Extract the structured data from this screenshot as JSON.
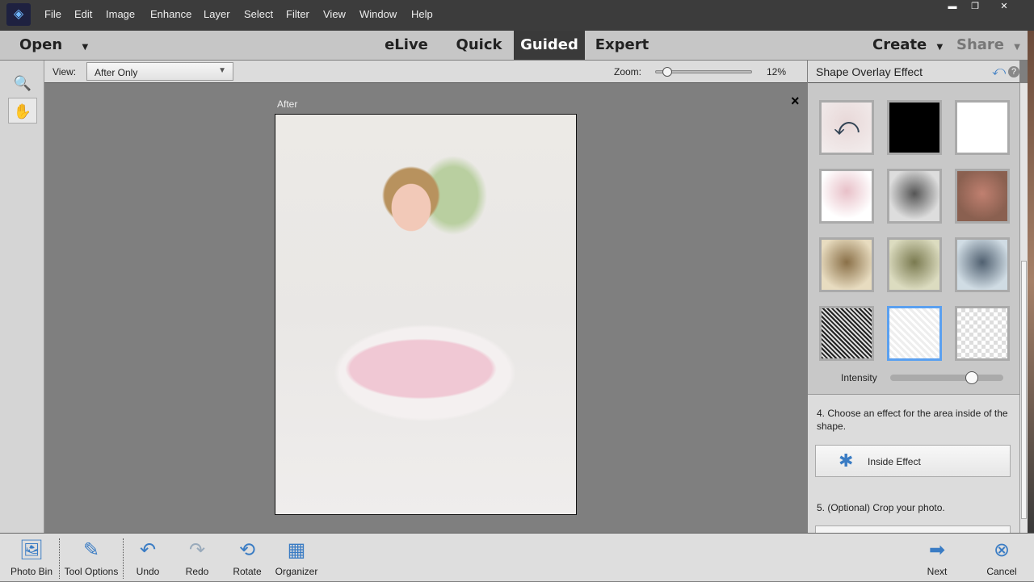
{
  "menu": [
    "File",
    "Edit",
    "Image",
    "Enhance",
    "Layer",
    "Select",
    "Filter",
    "View",
    "Window",
    "Help"
  ],
  "window_controls": {
    "minimize": "▬",
    "maximize": "❐",
    "close": "✕"
  },
  "modes": {
    "open": "Open",
    "elive": "eLive",
    "quick": "Quick",
    "guided": "Guided",
    "expert": "Expert",
    "create": "Create",
    "share": "Share"
  },
  "options": {
    "view_label": "View:",
    "view_value": "After Only",
    "zoom_label": "Zoom:",
    "zoom_value": "12%",
    "zoom_fraction": 0.12
  },
  "canvas": {
    "label": "After",
    "close": "×"
  },
  "panel": {
    "title": "Shape Overlay Effect",
    "intensity_label": "Intensity",
    "intensity": 0.72,
    "step4": "4. Choose an effect for the area inside of the shape.",
    "inside_button": "Inside Effect",
    "step5": "5. (Optional) Crop your photo.",
    "thumbnails": [
      "reset",
      "black",
      "white",
      "pink-tint",
      "grayscale",
      "color",
      "sepia",
      "olive",
      "cool-blue",
      "dark-texture",
      "light-texture",
      "transparent"
    ],
    "selected_thumbnail": "light-texture"
  },
  "accent": "#3a7cc4",
  "bottom": {
    "photo_bin": "Photo Bin",
    "tool_options": "Tool Options",
    "undo": "Undo",
    "redo": "Redo",
    "rotate": "Rotate",
    "organizer": "Organizer",
    "next": "Next",
    "cancel": "Cancel"
  }
}
